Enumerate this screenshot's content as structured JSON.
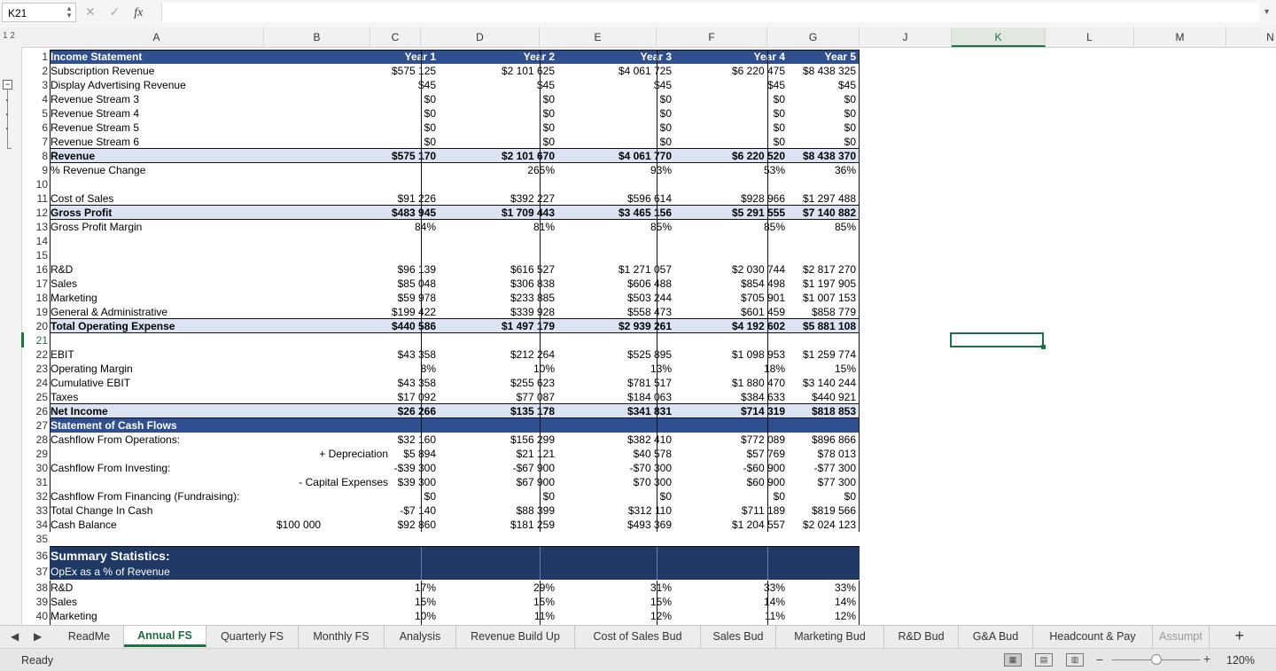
{
  "name_box": "K21",
  "formula_bar": {
    "fx": "fx",
    "cancel": "✕",
    "confirm": "✓",
    "value": ""
  },
  "outline_levels": "1 2",
  "columns": [
    {
      "id": "col-A",
      "label": "A"
    },
    {
      "id": "col-B",
      "label": "B"
    },
    {
      "id": "col-C",
      "label": "C"
    },
    {
      "id": "col-D",
      "label": "D"
    },
    {
      "id": "col-E",
      "label": "E"
    },
    {
      "id": "col-F",
      "label": "F"
    },
    {
      "id": "col-G",
      "label": "G"
    },
    {
      "id": "col-J",
      "label": "J"
    },
    {
      "id": "col-K",
      "label": "K",
      "selected": true
    },
    {
      "id": "col-L",
      "label": "L"
    },
    {
      "id": "col-M",
      "label": "M"
    },
    {
      "id": "col-N",
      "label": "N"
    }
  ],
  "rows": [
    {
      "n": "1",
      "style": "blue",
      "a": "Income Statement",
      "c": "Year 1",
      "d": "Year 2",
      "e": "Year 3",
      "f": "Year 4",
      "g": "Year 5"
    },
    {
      "n": "2",
      "a": "Subscription Revenue",
      "c": "$575 125",
      "d": "$2 101 625",
      "e": "$4 061 725",
      "f": "$6 220 475",
      "g": "$8 438 325"
    },
    {
      "n": "3",
      "a": "Display Advertising Revenue",
      "c": "$45",
      "d": "$45",
      "e": "$45",
      "f": "$45",
      "g": "$45"
    },
    {
      "n": "4",
      "a": "Revenue Stream 3",
      "c": "$0",
      "d": "$0",
      "e": "$0",
      "f": "$0",
      "g": "$0"
    },
    {
      "n": "5",
      "a": "Revenue Stream 4",
      "c": "$0",
      "d": "$0",
      "e": "$0",
      "f": "$0",
      "g": "$0"
    },
    {
      "n": "6",
      "a": "Revenue Stream 5",
      "c": "$0",
      "d": "$0",
      "e": "$0",
      "f": "$0",
      "g": "$0"
    },
    {
      "n": "7",
      "a": "Revenue Stream 6",
      "c": "$0",
      "d": "$0",
      "e": "$0",
      "f": "$0",
      "g": "$0"
    },
    {
      "n": "8",
      "style": "light",
      "a": "Revenue",
      "c": "$575 170",
      "d": "$2 101 670",
      "e": "$4 061 770",
      "f": "$6 220 520",
      "g": "$8 438 370"
    },
    {
      "n": "9",
      "a": "% Revenue Change",
      "c": "",
      "d": "265%",
      "e": "93%",
      "f": "53%",
      "g": "36%"
    },
    {
      "n": "10",
      "a": ""
    },
    {
      "n": "11",
      "a": "Cost of Sales",
      "c": "$91 226",
      "d": "$392 227",
      "e": "$596 614",
      "f": "$928 966",
      "g": "$1 297 488"
    },
    {
      "n": "12",
      "style": "light",
      "a": "Gross Profit",
      "c": "$483 945",
      "d": "$1 709 443",
      "e": "$3 465 156",
      "f": "$5 291 555",
      "g": "$7 140 882"
    },
    {
      "n": "13",
      "a": "Gross Profit Margin",
      "c": "84%",
      "d": "81%",
      "e": "85%",
      "f": "85%",
      "g": "85%"
    },
    {
      "n": "14",
      "a": ""
    },
    {
      "n": "15",
      "a": ""
    },
    {
      "n": "16",
      "a": "R&D",
      "c": "$96 139",
      "d": "$616 527",
      "e": "$1 271 057",
      "f": "$2 030 744",
      "g": "$2 817 270"
    },
    {
      "n": "17",
      "a": "Sales",
      "c": "$85 048",
      "d": "$306 838",
      "e": "$606 488",
      "f": "$854 498",
      "g": "$1 197 905"
    },
    {
      "n": "18",
      "a": "Marketing",
      "c": "$59 978",
      "d": "$233 885",
      "e": "$503 244",
      "f": "$705 901",
      "g": "$1 007 153"
    },
    {
      "n": "19",
      "a": "General & Administrative",
      "c": "$199 422",
      "d": "$339 928",
      "e": "$558 473",
      "f": "$601 459",
      "g": "$858 779"
    },
    {
      "n": "20",
      "style": "light",
      "a": "Total Operating Expense",
      "c": "$440 586",
      "d": "$1 497 179",
      "e": "$2 939 261",
      "f": "$4 192 602",
      "g": "$5 881 108"
    },
    {
      "n": "21",
      "a": "",
      "selected": true
    },
    {
      "n": "22",
      "a": "EBIT",
      "c": "$43 358",
      "d": "$212 264",
      "e": "$525 895",
      "f": "$1 098 953",
      "g": "$1 259 774"
    },
    {
      "n": "23",
      "a": "Operating Margin",
      "c": "8%",
      "d": "10%",
      "e": "13%",
      "f": "18%",
      "g": "15%"
    },
    {
      "n": "24",
      "a": "Cumulative EBIT",
      "c": "$43 358",
      "d": "$255 623",
      "e": "$781 517",
      "f": "$1 880 470",
      "g": "$3 140 244"
    },
    {
      "n": "25",
      "a": "Taxes",
      "c": "$17 092",
      "d": "$77 087",
      "e": "$184 063",
      "f": "$384 633",
      "g": "$440 921"
    },
    {
      "n": "26",
      "style": "light",
      "a": "Net Income",
      "c": "$26 266",
      "d": "$135 178",
      "e": "$341 831",
      "f": "$714 319",
      "g": "$818 853"
    },
    {
      "n": "27",
      "style": "blue",
      "a": "Statement of Cash Flows"
    },
    {
      "n": "28",
      "a": "Cashflow From Operations:",
      "c": "$32 160",
      "d": "$156 299",
      "e": "$382 410",
      "f": "$772 089",
      "g": "$896 866"
    },
    {
      "n": "29",
      "a": "",
      "b": "+ Depreciation",
      "c": "$5 894",
      "d": "$21 121",
      "e": "$40 578",
      "f": "$57 769",
      "g": "$78 013"
    },
    {
      "n": "30",
      "a": "Cashflow From Investing:",
      "c": "-$39 300",
      "d": "-$67 900",
      "e": "-$70 300",
      "f": "-$60 900",
      "g": "-$77 300"
    },
    {
      "n": "31",
      "a": "",
      "b": "- Capital Expenses",
      "c": "$39 300",
      "d": "$67 900",
      "e": "$70 300",
      "f": "$60 900",
      "g": "$77 300"
    },
    {
      "n": "32",
      "a": "Cashflow From Financing (Fundraising):",
      "c": "$0",
      "d": "$0",
      "e": "$0",
      "f": "$0",
      "g": "$0"
    },
    {
      "n": "33",
      "a": "Total Change In Cash",
      "c": "-$7 140",
      "d": "$88 399",
      "e": "$312 110",
      "f": "$711 189",
      "g": "$819 566"
    },
    {
      "n": "34",
      "a": "Cash Balance",
      "b": "$100 000",
      "b_align": "left",
      "c": "$92 860",
      "d": "$181 259",
      "e": "$493 369",
      "f": "$1 204 557",
      "g": "$2 024 123"
    },
    {
      "n": "35",
      "a": ""
    }
  ],
  "summary": {
    "row36": {
      "n": "36",
      "label": "Summary Statistics:"
    },
    "row37": {
      "n": "37",
      "label": "OpEx as a % of Revenue"
    },
    "rows": [
      {
        "n": "38",
        "a": "R&D",
        "c": "17%",
        "d": "29%",
        "e": "31%",
        "f": "33%",
        "g": "33%"
      },
      {
        "n": "39",
        "a": "Sales",
        "c": "15%",
        "d": "15%",
        "e": "15%",
        "f": "14%",
        "g": "14%"
      },
      {
        "n": "40",
        "a": "Marketing",
        "c": "10%",
        "d": "11%",
        "e": "12%",
        "f": "11%",
        "g": "12%"
      }
    ]
  },
  "sheet_tabs": [
    {
      "label": "ReadMe"
    },
    {
      "label": "Annual FS",
      "active": true
    },
    {
      "label": "Quarterly FS"
    },
    {
      "label": "Monthly FS"
    },
    {
      "label": "Analysis"
    },
    {
      "label": "Revenue Build Up"
    },
    {
      "label": "Cost of Sales Bud"
    },
    {
      "label": "Sales Bud"
    },
    {
      "label": "Marketing Bud"
    },
    {
      "label": "R&D Bud"
    },
    {
      "label": "G&A Bud"
    },
    {
      "label": "Headcount & Pay"
    },
    {
      "label": "Assumpt"
    }
  ],
  "status": {
    "ready": "Ready",
    "zoom": "120%"
  },
  "colors": {
    "header_blue": "#2f4f8f",
    "summary_navy": "#1f3864",
    "light_band": "#dbe4f3",
    "excel_green": "#1e7145"
  }
}
